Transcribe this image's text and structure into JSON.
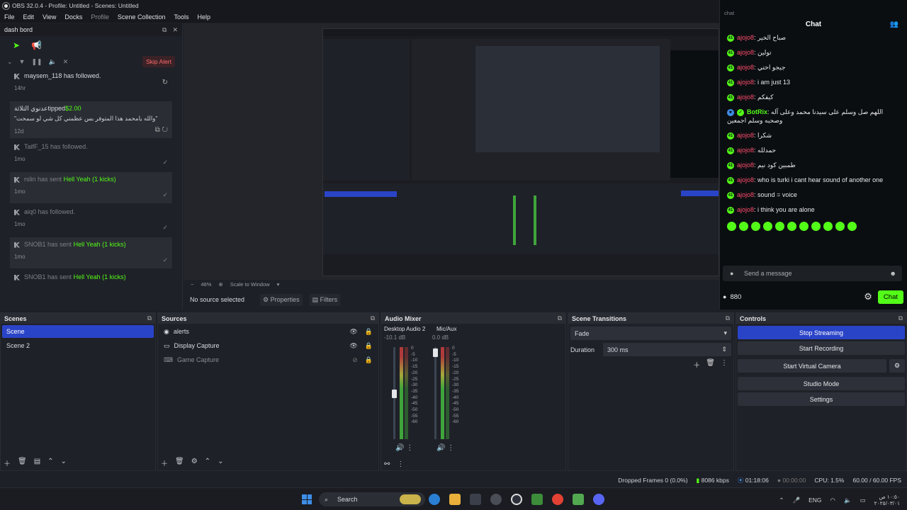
{
  "window": {
    "title": "OBS 32.0.4 - Profile: Untitled - Scenes: Untitled"
  },
  "menu": [
    "File",
    "Edit",
    "View",
    "Docks",
    "Profile",
    "Scene Collection",
    "Tools",
    "Help"
  ],
  "dash": {
    "title": "dash bord",
    "skip_alert": "Skip Alert",
    "events": [
      {
        "name": "maysem_118",
        "text": "has followed.",
        "time": "14hr"
      },
      {
        "name": "عدنوي الثلاثة",
        "text": "tipped",
        "amount": "$2.00",
        "message": "\"والله يامحمد هذا المتوفر بس عظمني كل شي لو سمحت\"",
        "time": "12d"
      },
      {
        "name": "TaifF_15",
        "text": "has followed.",
        "time": "1mo"
      },
      {
        "name": "rslin",
        "text": "has sent",
        "gift": "Hell Yeah (1 kicks)",
        "time": "1mo"
      },
      {
        "name": "aiq0",
        "text": "has followed.",
        "time": "1mo"
      },
      {
        "name": "SNOB1",
        "text": "has sent",
        "gift": "Hell Yeah (1 kicks)",
        "time": "1mo"
      },
      {
        "name": "SNOB1",
        "text": "has sent",
        "gift": "Hell Yeah (1 kicks)",
        "time": "1mo"
      }
    ]
  },
  "preview": {
    "zoom": "48%",
    "scale_mode": "Scale to Window",
    "no_source": "No source selected",
    "properties": "Properties",
    "filters": "Filters"
  },
  "chat": {
    "label": "chat",
    "title": "Chat",
    "messages": [
      {
        "user": "ajojo8",
        "text": "صباح الخير"
      },
      {
        "user": "ajojo8",
        "text": "تولين"
      },
      {
        "user": "ajojo8",
        "text": "جيجو اختي"
      },
      {
        "user": "ajojo8",
        "text": "i am just 13"
      },
      {
        "user": "ajojo8",
        "text": "كيفكم"
      },
      {
        "user": "BotRix",
        "text": "اللهم صل وسلم على سيدنا محمد وعلى آله وصحبه وسلم اجمعين"
      },
      {
        "user": "ajojo8",
        "text": "شكرا"
      },
      {
        "user": "ajojo8",
        "text": "حمدلله"
      },
      {
        "user": "ajojo8",
        "text": "طمبين كود نيم"
      },
      {
        "user": "ajojo8",
        "text": "who is turki i cant hear sound of another one"
      },
      {
        "user": "ajojo8",
        "text": "sound = voice"
      },
      {
        "user": "ajojo8",
        "text": "i think you are alone"
      }
    ],
    "input_placeholder": "Send a message",
    "viewers": "880",
    "send_label": "Chat"
  },
  "scenes": {
    "title": "Scenes",
    "items": [
      "Scene",
      "Scene 2"
    ]
  },
  "sources": {
    "title": "Sources",
    "items": [
      "alerts",
      "Display Capture",
      "Game Capture"
    ]
  },
  "mixer": {
    "title": "Audio Mixer",
    "channels": [
      {
        "name": "Desktop Audio 2",
        "db": "-10.1 dB",
        "level": 0.55
      },
      {
        "name": "Mic/Aux",
        "db": "0.0 dB",
        "level": 0.95
      }
    ],
    "scale": [
      "0",
      "-5",
      "-10",
      "-15",
      "-20",
      "-25",
      "-30",
      "-35",
      "-40",
      "-45",
      "-50",
      "-55",
      "-60"
    ]
  },
  "transitions": {
    "title": "Scene Transitions",
    "type": "Fade",
    "duration_label": "Duration",
    "duration": "300 ms"
  },
  "controls": {
    "title": "Controls",
    "stop_streaming": "Stop Streaming",
    "start_recording": "Start Recording",
    "start_virtual_camera": "Start Virtual Camera",
    "studio_mode": "Studio Mode",
    "settings": "Settings"
  },
  "status": {
    "dropped": "Dropped Frames 0 (0.0%)",
    "bitrate": "8086 kbps",
    "stream_time": "01:18:06",
    "rec_time": "00:00:00",
    "cpu": "CPU: 1.5%",
    "fps": "60.00 / 60.00 FPS"
  },
  "taskbar": {
    "search": "Search",
    "lang": "ENG",
    "time": "١٠:٥٠ ص",
    "date": "٢٠٢٥/٠٣/٠١"
  },
  "colors": {
    "accent_blue": "#2a44c8",
    "kick_green": "#53fc18",
    "username_red": "#ff4d6d"
  }
}
